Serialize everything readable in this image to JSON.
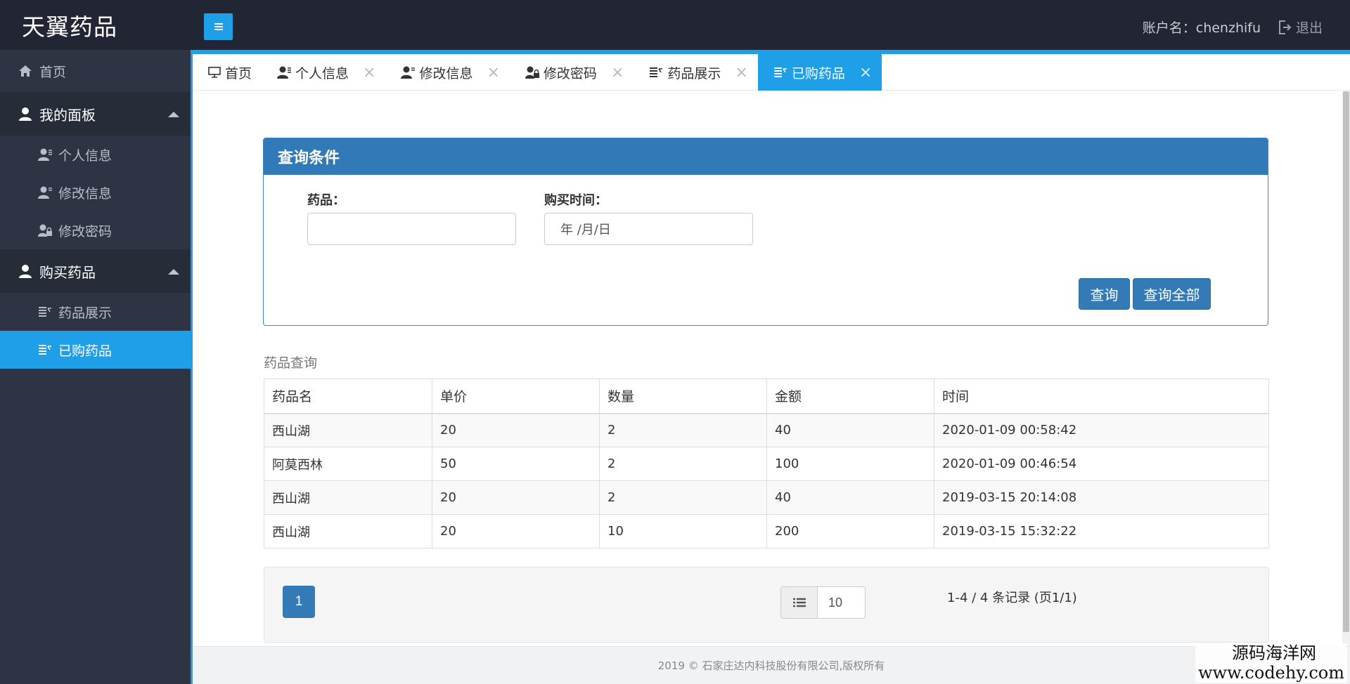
{
  "header": {
    "brand": "天翼药品",
    "account_label": "账户名：chenzhifu",
    "logout_label": "退出"
  },
  "sidebar": {
    "home_label": "首页",
    "groups": [
      {
        "label": "我的面板",
        "items": [
          {
            "label": "个人信息"
          },
          {
            "label": "修改信息"
          },
          {
            "label": "修改密码"
          }
        ]
      },
      {
        "label": "购买药品",
        "items": [
          {
            "label": "药品展示"
          },
          {
            "label": "已购药品"
          }
        ]
      }
    ],
    "active_item": "已购药品"
  },
  "tabs": [
    {
      "label": "首页",
      "icon": "monitor-icon",
      "closable": false
    },
    {
      "label": "个人信息",
      "icon": "user-icon",
      "closable": true
    },
    {
      "label": "修改信息",
      "icon": "user-edit-icon",
      "closable": true
    },
    {
      "label": "修改密码",
      "icon": "user-lock-icon",
      "closable": true
    },
    {
      "label": "药品展示",
      "icon": "list-icon",
      "closable": true
    },
    {
      "label": "已购药品",
      "icon": "list-icon",
      "closable": true,
      "active": true
    }
  ],
  "query": {
    "title": "查询条件",
    "drug_label": "药品：",
    "drug_value": "",
    "time_label": "购买时间：",
    "time_placeholder": "年 /月/日",
    "search_button": "查询",
    "search_all_button": "查询全部"
  },
  "results": {
    "title": "药品查询",
    "columns": [
      "药品名",
      "单价",
      "数量",
      "金额",
      "时间"
    ],
    "rows": [
      [
        "西山湖",
        "20",
        "2",
        "40",
        "2020-01-09 00:58:42"
      ],
      [
        "阿莫西林",
        "50",
        "2",
        "100",
        "2020-01-09 00:46:54"
      ],
      [
        "西山湖",
        "20",
        "2",
        "40",
        "2019-03-15 20:14:08"
      ],
      [
        "西山湖",
        "20",
        "10",
        "200",
        "2019-03-15 15:32:22"
      ]
    ]
  },
  "pagination": {
    "current_page": "1",
    "page_size": "10",
    "info": "1-4 / 4 条记录 (页1/1)"
  },
  "footer": {
    "copyright": "2019 © 石家庄达内科技股份有限公司,版权所有"
  },
  "watermark": {
    "line1": "源码海洋网",
    "line2": "www.codehy.com"
  },
  "colors": {
    "topbar": "#222533",
    "sidebar": "#2e3443",
    "accent": "#1e9fe8",
    "primary_button": "#337ab7"
  }
}
